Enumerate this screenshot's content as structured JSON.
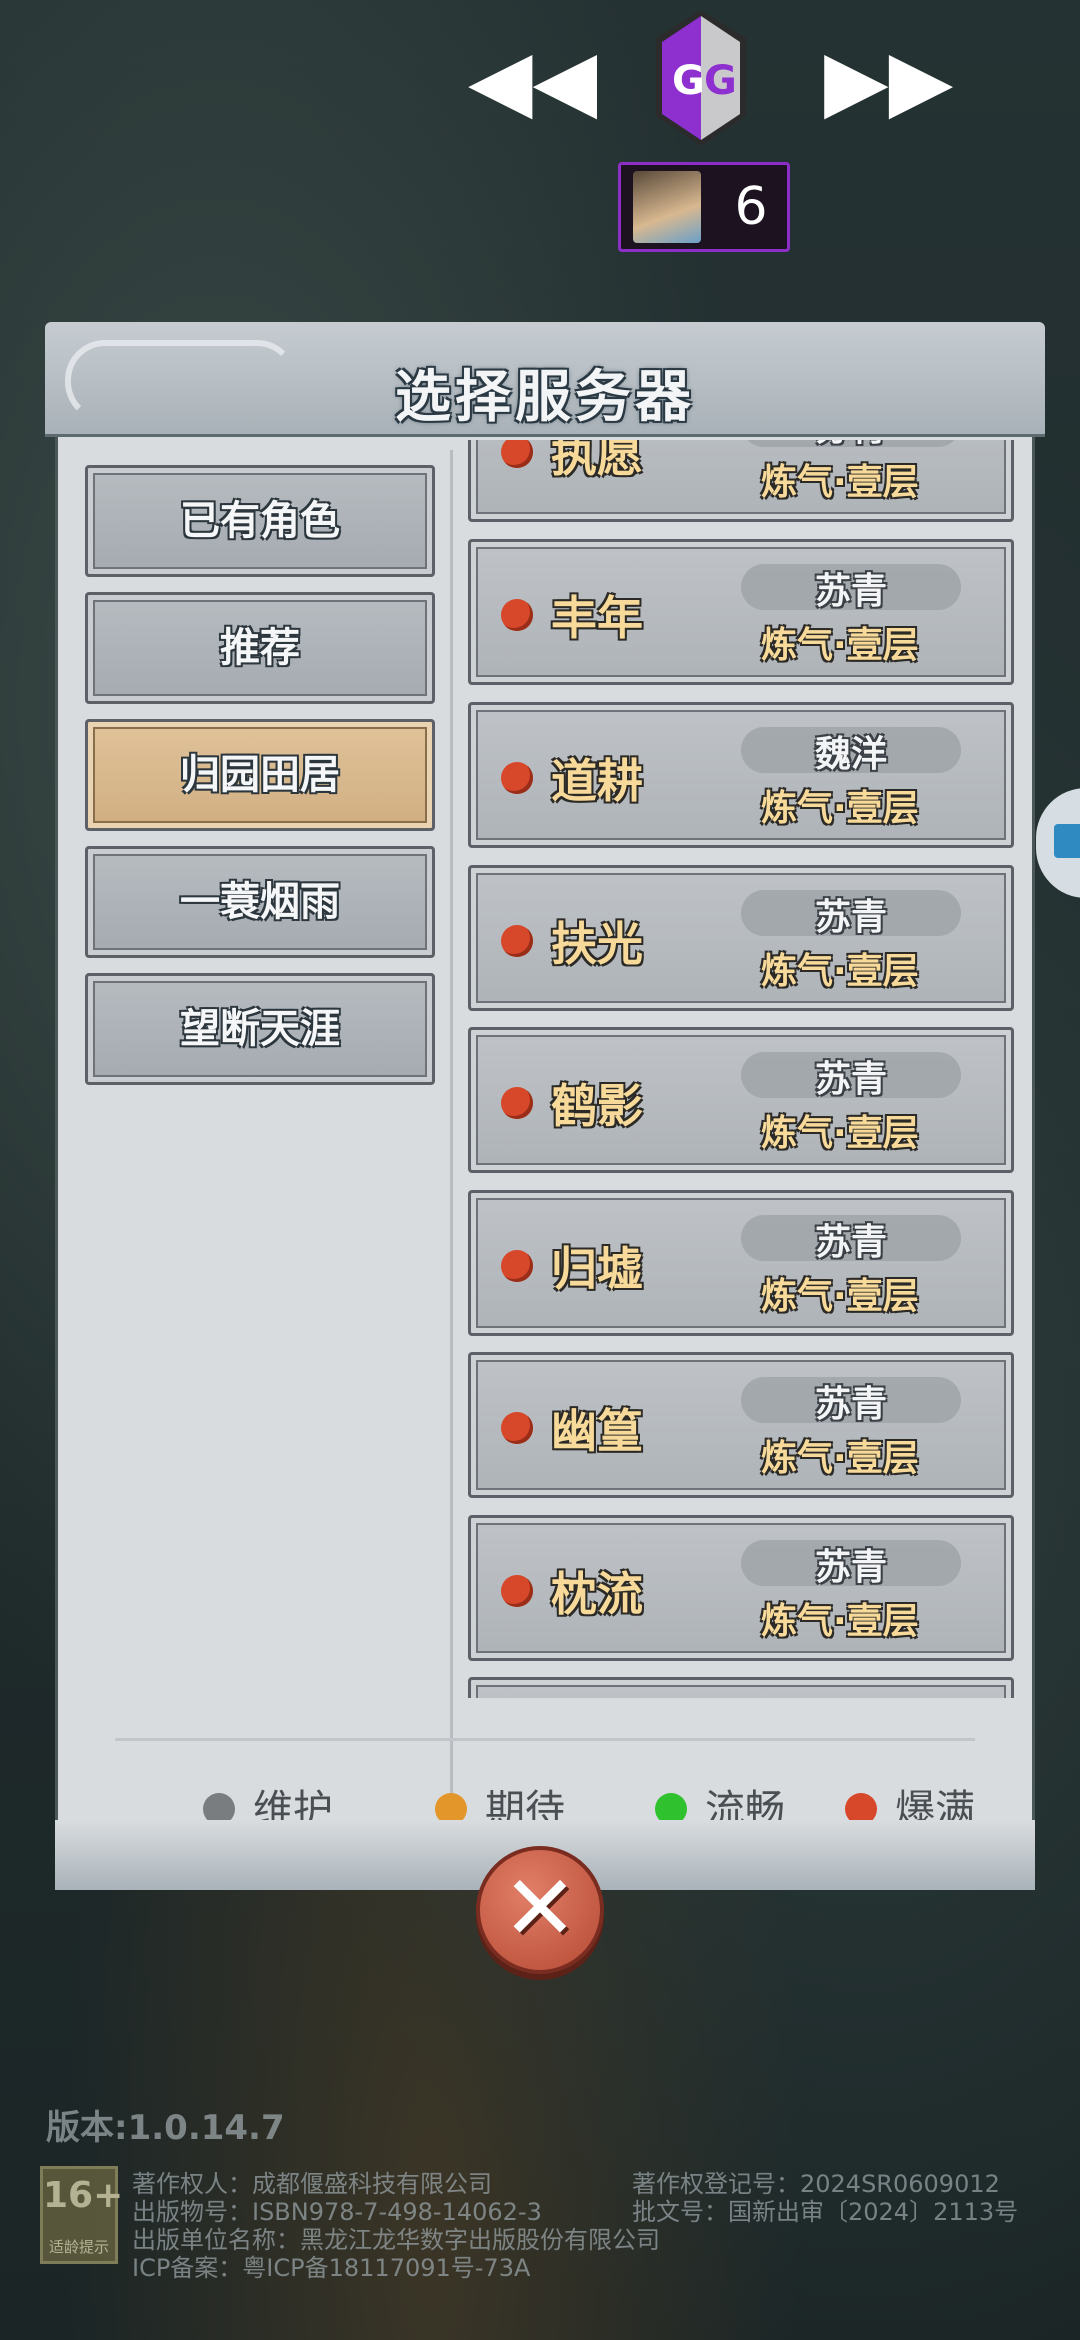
{
  "gg_overlay": {
    "prev_icon": "double-arrow-left-icon",
    "next_icon": "double-arrow-right-icon",
    "logo_letters": "GG",
    "process_count": "6"
  },
  "panel": {
    "title": "选择服务器",
    "categories": [
      {
        "label": "已有角色",
        "active": false
      },
      {
        "label": "推荐",
        "active": false
      },
      {
        "label": "归园田居",
        "active": true
      },
      {
        "label": "一蓑烟雨",
        "active": false
      },
      {
        "label": "望断天涯",
        "active": false
      }
    ],
    "servers": [
      {
        "name": "执愿",
        "role": "苏青",
        "level": "炼气·壹层",
        "status": "爆满"
      },
      {
        "name": "丰年",
        "role": "苏青",
        "level": "炼气·壹层",
        "status": "爆满"
      },
      {
        "name": "道耕",
        "role": "魏洋",
        "level": "炼气·壹层",
        "status": "爆满"
      },
      {
        "name": "扶光",
        "role": "苏青",
        "level": "炼气·壹层",
        "status": "爆满"
      },
      {
        "name": "鹤影",
        "role": "苏青",
        "level": "炼气·壹层",
        "status": "爆满"
      },
      {
        "name": "归墟",
        "role": "苏青",
        "level": "炼气·壹层",
        "status": "爆满"
      },
      {
        "name": "幽篁",
        "role": "苏青",
        "level": "炼气·壹层",
        "status": "爆满"
      },
      {
        "name": "枕流",
        "role": "苏青",
        "level": "炼气·壹层",
        "status": "爆满"
      }
    ],
    "legend": [
      {
        "label": "维护",
        "color": "#7a7d80"
      },
      {
        "label": "期待",
        "color": "#e3962a"
      },
      {
        "label": "流畅",
        "color": "#2fc12e"
      },
      {
        "label": "爆满",
        "color": "#d7472a"
      }
    ],
    "close_icon": "close-x-icon"
  },
  "footer": {
    "version": "版本:1.0.14.7",
    "age_rating": "16+",
    "age_rating_label": "适龄提示",
    "copyright_owner": "著作权人：成都偃盛科技有限公司",
    "copyright_reg": "著作权登记号：2024SR0609012",
    "isbn": "出版物号：ISBN978-7-498-14062-3",
    "approval": "批文号：国新出审〔2024〕2113号",
    "publisher": "出版单位名称：黑龙江龙华数字出版股份有限公司",
    "icp": "ICP备案：粤ICP备18117091号-73A"
  }
}
